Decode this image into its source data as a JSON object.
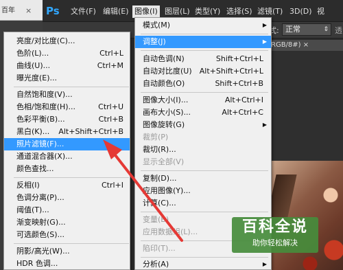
{
  "browser": {
    "tab_label": "百年",
    "close_glyph": "×"
  },
  "app": {
    "logo": "Ps",
    "menu": [
      "文件(F)",
      "编辑(E)",
      "图像(I)",
      "图层(L)",
      "类型(Y)",
      "选择(S)",
      "滤镜(T)",
      "3D(D)",
      "视"
    ],
    "active_menu": "图像(I)"
  },
  "options": {
    "mode_label": "式:",
    "mode_value": "正常",
    "opacity_label": "透"
  },
  "document": {
    "tab_label": "RGB/8#) ×"
  },
  "image_menu": {
    "items": [
      {
        "label": "模式(M)",
        "shortcut": "",
        "submenu": true,
        "disabled": false
      },
      {
        "label": "调整(J)",
        "shortcut": "",
        "submenu": true,
        "disabled": false,
        "highlight": true
      },
      {
        "label": "自动色调(N)",
        "shortcut": "Shift+Ctrl+L",
        "disabled": false
      },
      {
        "label": "自动对比度(U)",
        "shortcut": "Alt+Shift+Ctrl+L",
        "disabled": false
      },
      {
        "label": "自动颜色(O)",
        "shortcut": "Shift+Ctrl+B",
        "disabled": false
      },
      {
        "label": "图像大小(I)...",
        "shortcut": "Alt+Ctrl+I",
        "disabled": false
      },
      {
        "label": "画布大小(S)...",
        "shortcut": "Alt+Ctrl+C",
        "disabled": false
      },
      {
        "label": "图像旋转(G)",
        "shortcut": "",
        "submenu": true,
        "disabled": false
      },
      {
        "label": "裁剪(P)",
        "shortcut": "",
        "disabled": true
      },
      {
        "label": "裁切(R)...",
        "shortcut": "",
        "disabled": false
      },
      {
        "label": "显示全部(V)",
        "shortcut": "",
        "disabled": true
      },
      {
        "label": "复制(D)...",
        "shortcut": "",
        "disabled": false
      },
      {
        "label": "应用图像(Y)...",
        "shortcut": "",
        "disabled": false
      },
      {
        "label": "计算(C)...",
        "shortcut": "",
        "disabled": false
      },
      {
        "label": "变量(B)",
        "shortcut": "",
        "submenu": true,
        "disabled": true
      },
      {
        "label": "应用数据组(L)...",
        "shortcut": "",
        "disabled": true
      },
      {
        "label": "陷印(T)...",
        "shortcut": "",
        "disabled": true
      },
      {
        "label": "分析(A)",
        "shortcut": "",
        "submenu": true,
        "disabled": false
      }
    ]
  },
  "adjust_menu": {
    "items": [
      {
        "label": "亮度/对比度(C)...",
        "shortcut": ""
      },
      {
        "label": "色阶(L)...",
        "shortcut": "Ctrl+L"
      },
      {
        "label": "曲线(U)...",
        "shortcut": "Ctrl+M"
      },
      {
        "label": "曝光度(E)...",
        "shortcut": ""
      },
      {
        "label": "自然饱和度(V)...",
        "shortcut": ""
      },
      {
        "label": "色相/饱和度(H)...",
        "shortcut": "Ctrl+U"
      },
      {
        "label": "色彩平衡(B)...",
        "shortcut": "Ctrl+B"
      },
      {
        "label": "黑白(K)...",
        "shortcut": "Alt+Shift+Ctrl+B"
      },
      {
        "label": "照片滤镜(F)...",
        "shortcut": "",
        "highlight": true
      },
      {
        "label": "通道混合器(X)...",
        "shortcut": ""
      },
      {
        "label": "颜色查找...",
        "shortcut": ""
      },
      {
        "label": "反相(I)",
        "shortcut": "Ctrl+I"
      },
      {
        "label": "色调分离(P)...",
        "shortcut": ""
      },
      {
        "label": "阈值(T)...",
        "shortcut": ""
      },
      {
        "label": "渐变映射(G)...",
        "shortcut": ""
      },
      {
        "label": "可选颜色(S)...",
        "shortcut": ""
      },
      {
        "label": "阴影/高光(W)...",
        "shortcut": ""
      },
      {
        "label": "HDR 色调...",
        "shortcut": ""
      }
    ]
  },
  "watermark": {
    "title": "百科全说",
    "subtitle": "助你轻松解决"
  },
  "colors": {
    "highlight": "#3399ff",
    "menu_bg": "#f0f0f0",
    "arrow": "#e53935",
    "ps_blue": "#31a8ff",
    "watermark": "#468c3c"
  }
}
